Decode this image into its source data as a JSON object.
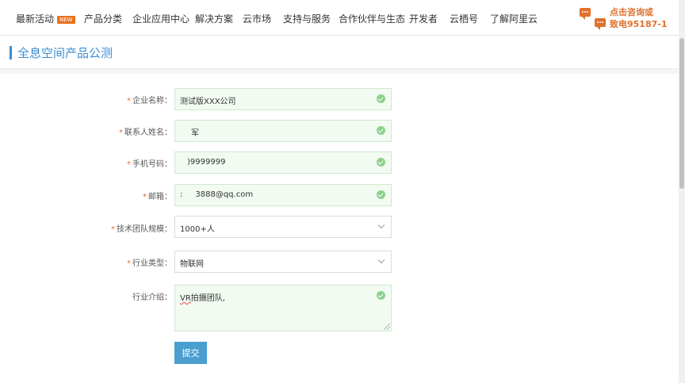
{
  "nav": {
    "items": [
      "最新活动",
      "产品分类",
      "企业应用中心",
      "解决方案",
      "云市场",
      "支持与服务",
      "合作伙伴与生态",
      "开发者",
      "云栖号",
      "了解阿里云"
    ],
    "new_badge": "NEW",
    "consult_line1": "点击咨询或",
    "consult_line2": "致电95187-1"
  },
  "page": {
    "title": "全息空间产品公测"
  },
  "form": {
    "required_mark": "*",
    "company_label": "企业名称：",
    "company_value": "测试版XXX公司",
    "contact_label": "联系人姓名：",
    "contact_value": "军",
    "phone_label": "手机号码：",
    "phone_value": ")9999999",
    "email_label": "邮箱：",
    "email_prefix": ":",
    "email_value": "3888@qq.com",
    "team_size_label": "技术团队规模：",
    "team_size_value": "1000+人",
    "industry_label": "行业类型：",
    "industry_value": "物联网",
    "intro_label": "行业介绍：",
    "intro_value_vr": "VR",
    "intro_value_rest": "拍摄团队,",
    "submit_label": "提交"
  },
  "colors": {
    "accent": "#3b8ed3",
    "orange": "#e0712c",
    "valid_bg": "#f2fbf1",
    "valid_check": "#8dd08d",
    "submit": "#4a9fd0"
  }
}
